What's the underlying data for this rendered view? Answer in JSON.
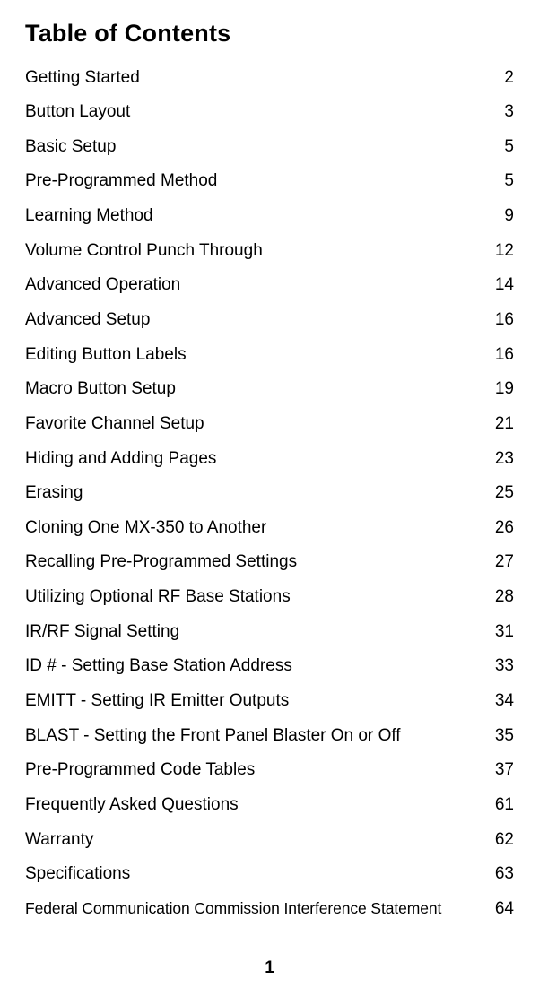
{
  "title": "Table of Contents",
  "toc": [
    {
      "label": "Getting Started",
      "page": "2"
    },
    {
      "label": "Button Layout",
      "page": "3"
    },
    {
      "label": "Basic Setup",
      "page": "5"
    },
    {
      "label": "Pre-Programmed Method",
      "page": "5"
    },
    {
      "label": "Learning Method",
      "page": "9"
    },
    {
      "label": "Volume Control Punch Through",
      "page": "12"
    },
    {
      "label": "Advanced Operation",
      "page": "14"
    },
    {
      "label": "Advanced Setup",
      "page": "16"
    },
    {
      "label": "Editing Button Labels",
      "page": "16"
    },
    {
      "label": "Macro Button Setup",
      "page": "19"
    },
    {
      "label": "Favorite Channel Setup",
      "page": "21"
    },
    {
      "label": "Hiding and Adding Pages",
      "page": "23"
    },
    {
      "label": "Erasing",
      "page": "25"
    },
    {
      "label": "Cloning One MX-350 to Another",
      "page": "26"
    },
    {
      "label": "Recalling Pre-Programmed Settings",
      "page": "27"
    },
    {
      "label": "Utilizing Optional RF Base Stations",
      "page": "28"
    },
    {
      "label": "IR/RF Signal Setting",
      "page": "31"
    },
    {
      "label": "ID # - Setting Base Station Address",
      "page": "33"
    },
    {
      "label": "EMITT - Setting IR Emitter Outputs",
      "page": "34"
    },
    {
      "label": "BLAST - Setting the Front Panel Blaster On or Off",
      "page": "35"
    },
    {
      "label": "Pre-Programmed Code Tables",
      "page": "37"
    },
    {
      "label": "Frequently Asked Questions",
      "page": "61"
    },
    {
      "label": "Warranty",
      "page": "62"
    },
    {
      "label": "Specifications",
      "page": "63"
    },
    {
      "label": "Federal Communication Commission Interference Statement",
      "page": "64",
      "small": true
    }
  ],
  "page_number": "1"
}
